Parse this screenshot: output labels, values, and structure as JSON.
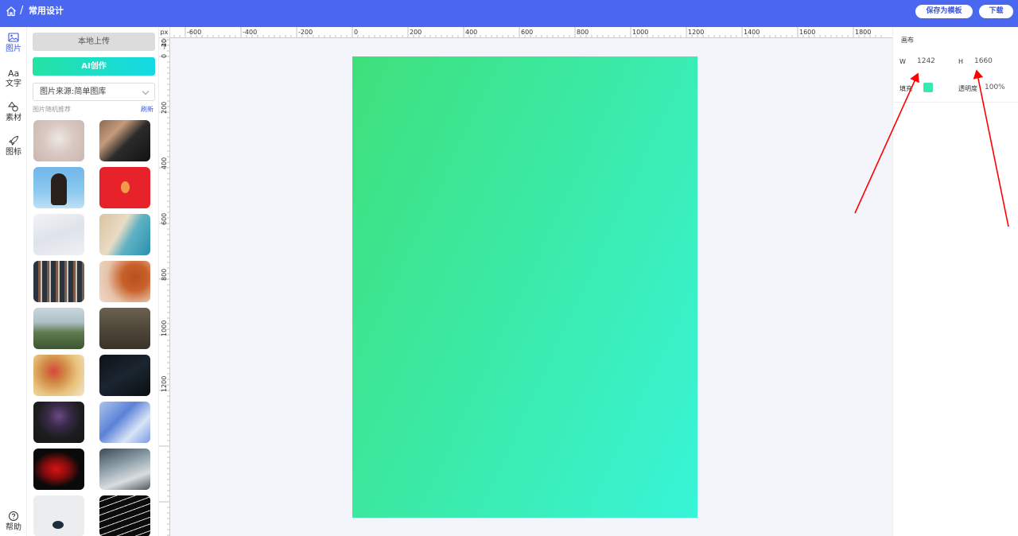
{
  "header": {
    "breadcrumb_sep": "/",
    "title": "常用设计",
    "save_template": "保存为模板",
    "download": "下载",
    "bg_color": "#4a67f0",
    "home_icon": "home-icon"
  },
  "iconnav": {
    "items": [
      {
        "label": "图片",
        "icon": "image-icon"
      },
      {
        "label": "文字",
        "icon": "text-icon"
      },
      {
        "label": "素材",
        "icon": "shapes-icon"
      },
      {
        "label": "图标",
        "icon": "rocket-icon"
      }
    ],
    "help": {
      "label": "帮助",
      "icon": "help-icon"
    }
  },
  "panel": {
    "upload": "本地上传",
    "ai_create": "AI创作",
    "source_value": "图片来源:简单图库",
    "rec_label": "图片随机推荐",
    "refresh": "刷新"
  },
  "ruler": {
    "unit": "px",
    "h_labels": [
      "-600",
      "-400",
      "-200",
      "0",
      "200",
      "400",
      "600",
      "800",
      "1000",
      "1200",
      "1400",
      "1600",
      "1800"
    ],
    "v_labels": [
      "-40",
      "-200",
      "0",
      "200",
      "400",
      "600",
      "800",
      "1000",
      "1200"
    ]
  },
  "canvas": {
    "gradient_from": "#3ee07a",
    "gradient_to": "#38f5d8"
  },
  "props": {
    "section": "画布",
    "w_label": "W",
    "w_value": "1242",
    "h_label": "H",
    "h_value": "1660",
    "fill_label": "填充",
    "fill_color": "#38e8b0",
    "opacity_label": "透明度",
    "opacity_value": "100%"
  },
  "annotation": {
    "arrow_color": "#ff0000"
  }
}
